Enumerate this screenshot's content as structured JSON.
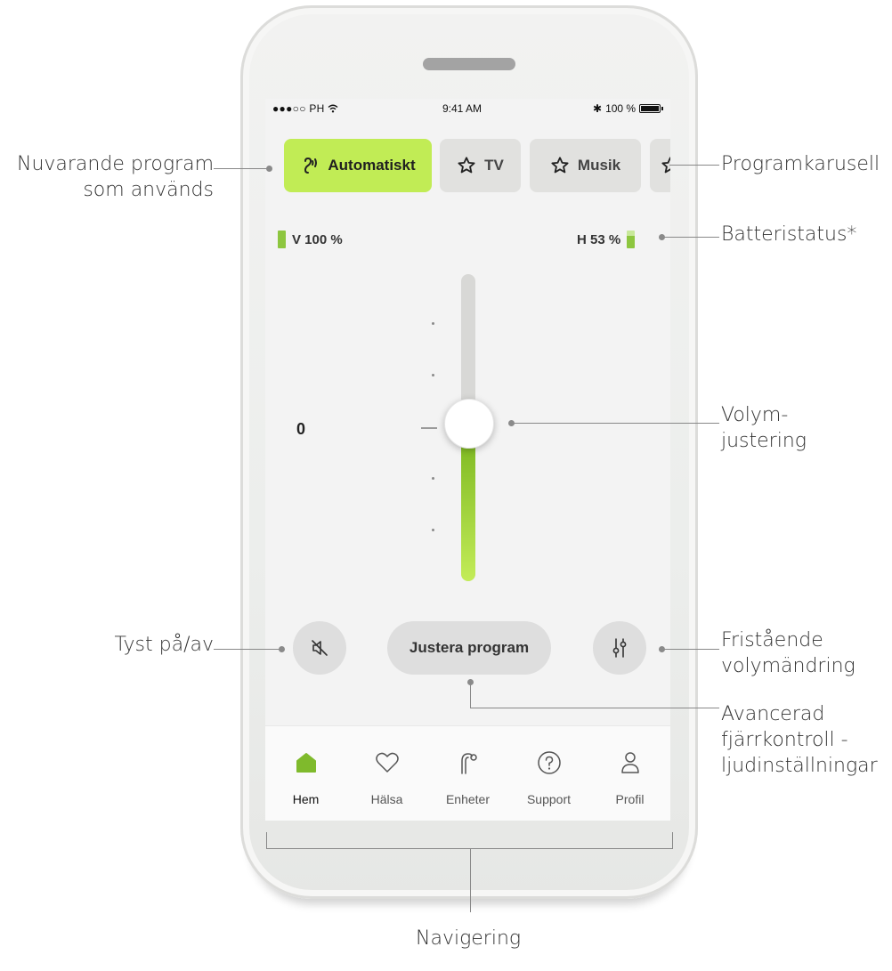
{
  "status_bar": {
    "carrier": "●●●○○ PH",
    "time": "9:41 AM",
    "bluetooth": "✱",
    "battery_text": "100 %"
  },
  "programs": [
    {
      "label": "Automatiskt",
      "icon": "ear-wave-icon",
      "active": true
    },
    {
      "label": "TV",
      "icon": "star-icon",
      "active": false
    },
    {
      "label": "Musik",
      "icon": "star-icon",
      "active": false
    }
  ],
  "battery": {
    "left_label": "V 100 %",
    "left_level": 1.0,
    "right_label": "H 53 %",
    "right_level": 0.53
  },
  "volume": {
    "value": "0",
    "fill_fraction": 0.5
  },
  "actions": {
    "mute_icon": "speaker-muted-icon",
    "adjust_label": "Justera program",
    "sliders_icon": "sliders-icon"
  },
  "nav": [
    {
      "label": "Hem",
      "icon": "home-icon",
      "active": true
    },
    {
      "label": "Hälsa",
      "icon": "heart-icon",
      "active": false
    },
    {
      "label": "Enheter",
      "icon": "hearing-aid-icon",
      "active": false
    },
    {
      "label": "Support",
      "icon": "question-icon",
      "active": false
    },
    {
      "label": "Profil",
      "icon": "person-icon",
      "active": false
    }
  ],
  "callouts": {
    "current_program": [
      "Nuvarande program",
      "som används"
    ],
    "carousel": "Programkarusell",
    "battery_status": "Batteristatus*",
    "volume": [
      "Volym-",
      "justering"
    ],
    "mute": "Tyst på/av",
    "independent_volume": [
      "Fristående",
      "volymändring"
    ],
    "advanced_remote": [
      "Avancerad",
      "fjärrkontroll -",
      "ljudinställningar"
    ],
    "navigation": "Navigering"
  },
  "colors": {
    "accent": "#c1ec55",
    "battery_green": "#8dc63f",
    "slider_green": "#79b51e"
  }
}
